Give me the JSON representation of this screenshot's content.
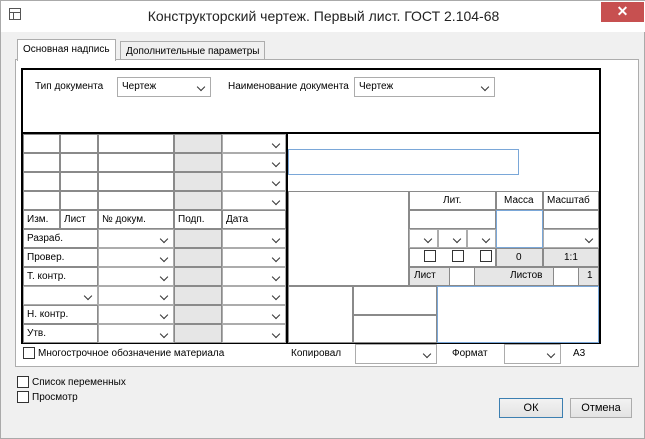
{
  "window": {
    "title": "Конструкторский чертеж. Первый лист. ГОСТ 2.104-68",
    "close": "✕"
  },
  "tabs": [
    {
      "label": "Основная надпись"
    },
    {
      "label": "Дополнительные параметры"
    }
  ],
  "doc": {
    "type_label": "Тип документа",
    "type_value": "Чертеж",
    "name_label": "Наименование документа",
    "name_value": "Чертеж"
  },
  "table": {
    "headers": {
      "izm": "Изм.",
      "list": "Лист",
      "ndoc": "№ докум.",
      "podp": "Подп.",
      "data": "Дата"
    },
    "roles": [
      "Разраб.",
      "Провер.",
      "Т. контр.",
      "Н. контр.",
      "Утв."
    ],
    "lit": "Лит.",
    "massa": "Масса",
    "masshtab": "Масштаб",
    "massa_value": "0",
    "masshtab_value": "1:1",
    "sheet_label": "Лист",
    "sheets_label": "Листов",
    "sheets_value": "1"
  },
  "bottom": {
    "multiline_label": "Многострочное обозначение материала",
    "kopiroval": "Копировал",
    "format": "Формат",
    "format_value": "А3"
  },
  "footer": {
    "variables": "Список переменных",
    "preview": "Просмотр",
    "ok": "ОК",
    "cancel": "Отмена"
  }
}
